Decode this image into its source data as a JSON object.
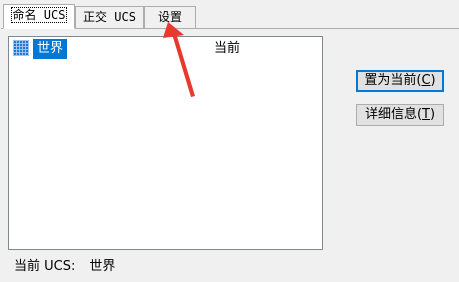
{
  "tabs": [
    {
      "label": "命名 UCS",
      "active": true
    },
    {
      "label": "正交 UCS",
      "active": false
    },
    {
      "label": "设置",
      "active": false
    }
  ],
  "list": {
    "rows": [
      {
        "name": "世界",
        "status": "当前",
        "selected": true
      }
    ]
  },
  "buttons": {
    "set_current": {
      "label": "置为当前",
      "key": "C"
    },
    "details": {
      "label": "详细信息",
      "key": "T"
    }
  },
  "status_bar": {
    "label": "当前 UCS:",
    "value": "世界"
  },
  "annotation": {
    "type": "red-arrow",
    "target": "settings tab",
    "color": "#e8392f"
  },
  "colors": {
    "selection": "#0078d7",
    "arrow": "#e8392f"
  }
}
